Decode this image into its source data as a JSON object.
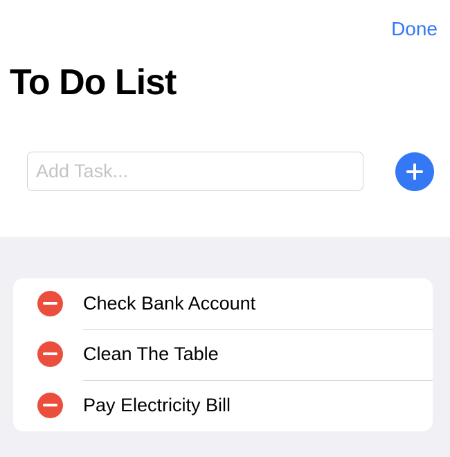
{
  "header": {
    "done_label": "Done",
    "title": "To Do List"
  },
  "add_task": {
    "placeholder": "Add Task...",
    "value": "",
    "button_icon": "plus-icon"
  },
  "tasks": [
    {
      "label": "Check Bank Account",
      "delete_icon": "minus-circle-icon"
    },
    {
      "label": "Clean The Table",
      "delete_icon": "minus-circle-icon"
    },
    {
      "label": "Pay Electricity Bill",
      "delete_icon": "minus-circle-icon"
    }
  ],
  "colors": {
    "accent": "#3478f6",
    "delete": "#eb4e3d",
    "background": "#ffffff",
    "grouped_background": "#f0f0f5",
    "placeholder": "#c4c4c6",
    "separator": "#d8d8dc"
  }
}
